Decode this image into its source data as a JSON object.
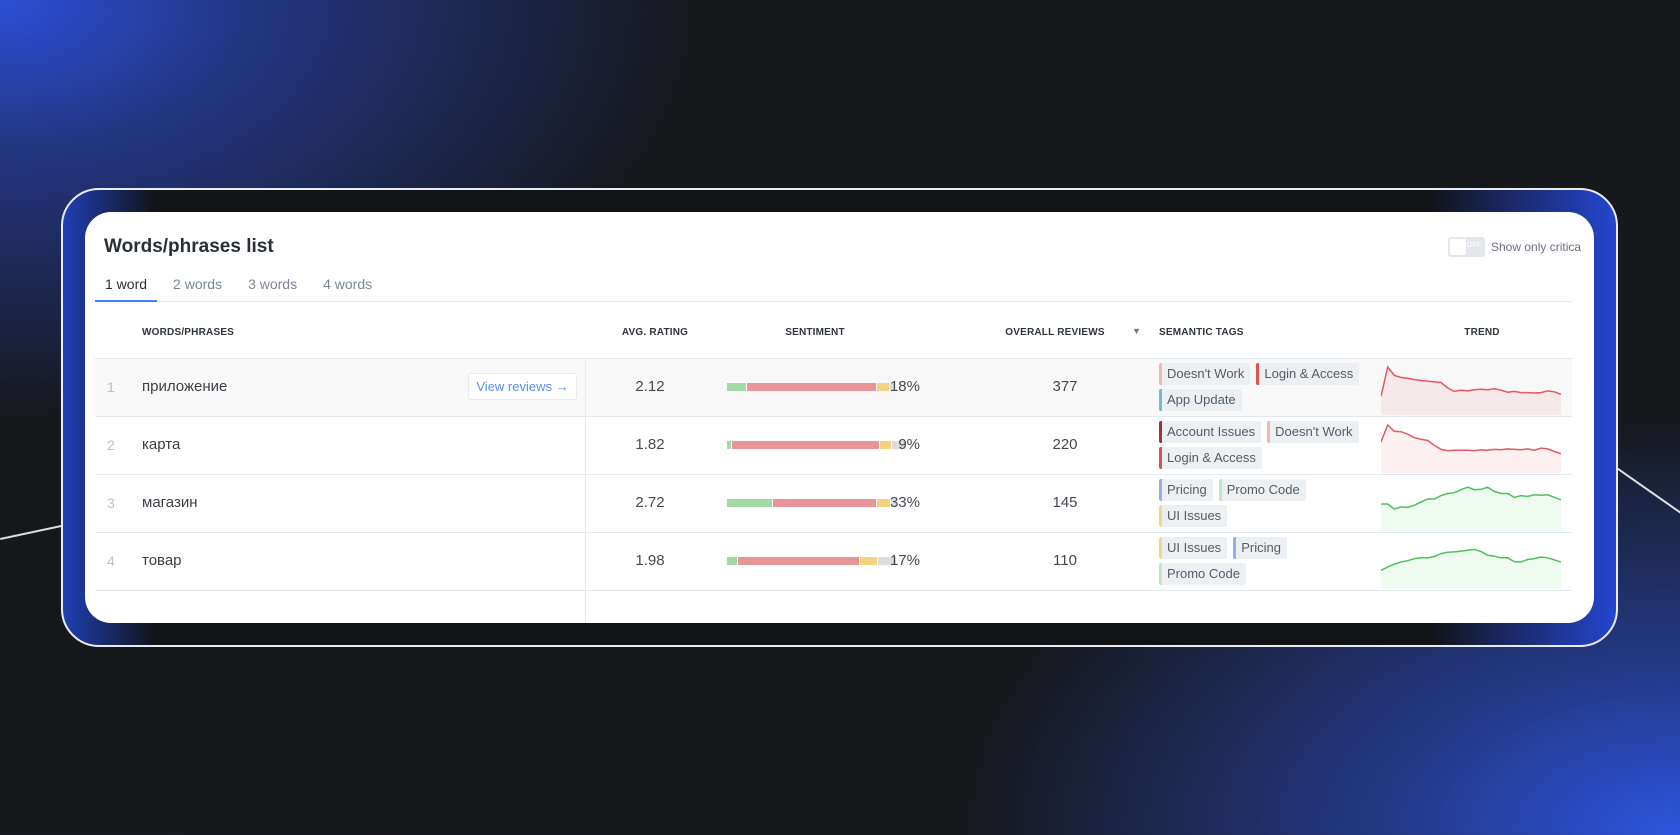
{
  "panel": {
    "title": "Words/phrases list",
    "toggle_state": "OFF",
    "toggle_label": "Show only critica"
  },
  "tabs": [
    {
      "label": "1 word",
      "active": true
    },
    {
      "label": "2 words"
    },
    {
      "label": "3 words"
    },
    {
      "label": "4 words"
    }
  ],
  "columns": {
    "words": "WORDS/PHRASES",
    "rating": "AVG. RATING",
    "sentiment": "SENTIMENT",
    "reviews": "OVERALL REVIEWS",
    "tags": "SEMANTIC TAGS",
    "trend": "TREND"
  },
  "view_reviews_label": "View reviews →",
  "sentiment_colors": {
    "positive": "#a3d9a5",
    "negative": "#e8959a",
    "neutral": "#f2d47e",
    "unknown": "#dcdcdc"
  },
  "tag_colors": {
    "Doesn't Work": "#f0b8a8",
    "Login & Access": "#d9534f",
    "App Update": "#6fb8e0",
    "Account Issues": "#a8322d",
    "Pricing": "#9aa8f0",
    "Promo Code": "#bfe8c0",
    "UI Issues": "#f0d58a"
  },
  "rows": [
    {
      "num": "1",
      "word": "приложение",
      "rating": "2.12",
      "sentiment": [
        11,
        77,
        7,
        3
      ],
      "pct": "18%",
      "reviews": "377",
      "tags": [
        "Doesn't Work",
        "Login & Access",
        "App Update"
      ],
      "trend_color": "#e8565f",
      "trend": [
        3,
        10,
        8,
        7.5,
        7.3,
        7,
        6.8,
        6.6,
        6.5,
        6.3,
        5,
        4.2,
        4.5,
        4.3,
        4.6,
        4.7,
        4.6,
        4.8,
        4.5,
        4,
        4.2,
        3.9,
        3.9,
        3.8,
        3.9,
        4.3,
        4.1,
        3.5
      ]
    },
    {
      "num": "2",
      "word": "карта",
      "rating": "1.82",
      "sentiment": [
        2,
        84,
        6,
        8
      ],
      "pct": "9%",
      "reviews": "220",
      "tags": [
        "Account Issues",
        "Doesn't Work",
        "Login & Access"
      ],
      "trend_color": "#e8565f",
      "trend": [
        6,
        10,
        8.5,
        8.4,
        7.8,
        7,
        6.6,
        6.3,
        5.2,
        4.2,
        3.9,
        4,
        4,
        4,
        3.9,
        4.1,
        4,
        4.2,
        4.1,
        4.3,
        4.2,
        4.1,
        4.3,
        4,
        4.5,
        4.3,
        3.7,
        3.2
      ]
    },
    {
      "num": "3",
      "word": "магазин",
      "rating": "2.72",
      "sentiment": [
        27,
        61,
        8,
        3
      ],
      "pct": "33%",
      "reviews": "145",
      "tags": [
        "Pricing",
        "Promo Code",
        "UI Issues"
      ],
      "trend_color": "#4cc35a",
      "trend": [
        5,
        5,
        3.8,
        4.3,
        4.2,
        4.7,
        5.5,
        6.2,
        6.2,
        7,
        7.5,
        7.7,
        8.4,
        9,
        8.4,
        8.5,
        9,
        8,
        7.5,
        7.5,
        6.6,
        7,
        6.8,
        7.2,
        7.1,
        7.2,
        6.6,
        6
      ]
    },
    {
      "num": "4",
      "word": "товар",
      "rating": "1.98",
      "sentiment": [
        6,
        72,
        10,
        11
      ],
      "pct": "17%",
      "reviews": "110",
      "tags": [
        "UI Issues",
        "Pricing",
        "Promo Code"
      ],
      "trend_color": "#4cc35a",
      "trend": [
        3,
        3.8,
        4.5,
        5,
        5.3,
        5.8,
        6,
        6,
        6.3,
        7,
        7.3,
        7.4,
        7.6,
        7.8,
        8,
        7.5,
        6.6,
        6.4,
        6,
        6,
        5.1,
        5,
        5.6,
        5.8,
        6.2,
        6,
        5.5,
        5
      ]
    }
  ]
}
